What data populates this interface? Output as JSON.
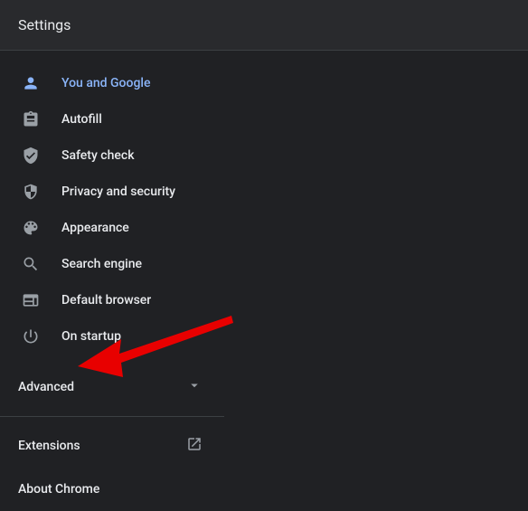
{
  "header": {
    "title": "Settings"
  },
  "sidebar": {
    "items": [
      {
        "label": "You and Google",
        "icon": "person-icon",
        "selected": true
      },
      {
        "label": "Autofill",
        "icon": "autofill-icon",
        "selected": false
      },
      {
        "label": "Safety check",
        "icon": "safety-check-icon",
        "selected": false
      },
      {
        "label": "Privacy and security",
        "icon": "shield-icon",
        "selected": false
      },
      {
        "label": "Appearance",
        "icon": "palette-icon",
        "selected": false
      },
      {
        "label": "Search engine",
        "icon": "search-icon",
        "selected": false
      },
      {
        "label": "Default browser",
        "icon": "browser-icon",
        "selected": false
      },
      {
        "label": "On startup",
        "icon": "power-icon",
        "selected": false
      }
    ],
    "advanced_label": "Advanced",
    "extensions_label": "Extensions",
    "about_label": "About Chrome"
  }
}
